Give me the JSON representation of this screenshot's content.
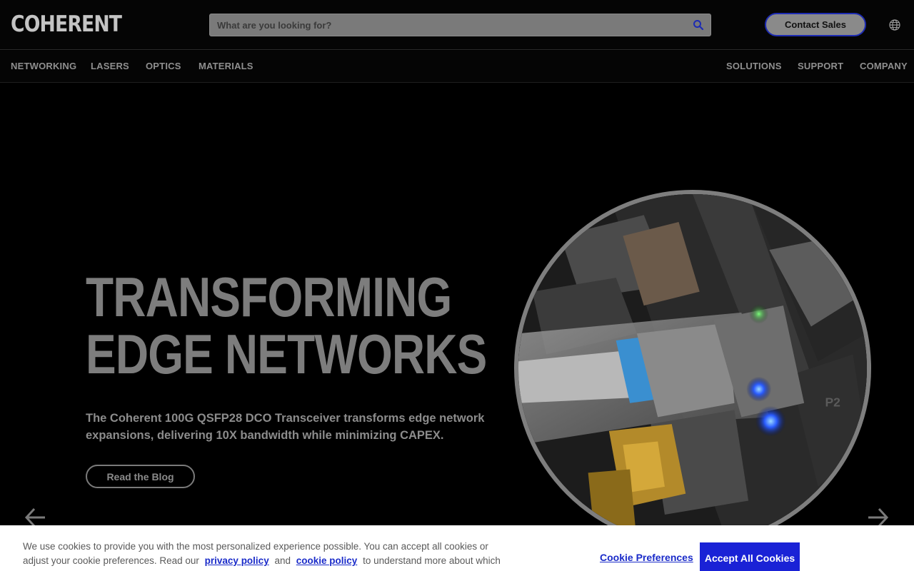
{
  "header": {
    "logo_text": "COHERENT",
    "search": {
      "placeholder": "What are you looking for?",
      "value": ""
    },
    "contact_label": "Contact Sales"
  },
  "nav": {
    "left": [
      "NETWORKING",
      "LASERS",
      "OPTICS",
      "MATERIALS"
    ],
    "right": [
      "SOLUTIONS",
      "SUPPORT",
      "COMPANY"
    ]
  },
  "hero": {
    "title_line1": "TRANSFORMING",
    "title_line2": "EDGE NETWORKS",
    "description": "The Coherent 100G QSFP28 DCO Transceiver transforms edge network expansions, delivering 10X bandwidth while minimizing CAPEX.",
    "cta_label": "Read the Blog",
    "image_label": "P2"
  },
  "cookie": {
    "text_before": "We use cookies to provide you with the most personalized experience possible. You can accept all cookies or adjust your cookie preferences. Read our",
    "privacy_link": "privacy policy",
    "and_text": "and",
    "cookie_link": "cookie policy",
    "text_after": "to understand more about which cookies we",
    "preferences_label": "Cookie Preferences",
    "accept_label": "Accept All Cookies"
  },
  "colors": {
    "accent": "#1a22d6",
    "link": "#1a2bc9",
    "contact_border": "#1d2bb3"
  },
  "icons": {
    "search": "search-icon",
    "globe": "globe-icon",
    "prev": "arrow-left-icon",
    "next": "arrow-right-icon"
  }
}
